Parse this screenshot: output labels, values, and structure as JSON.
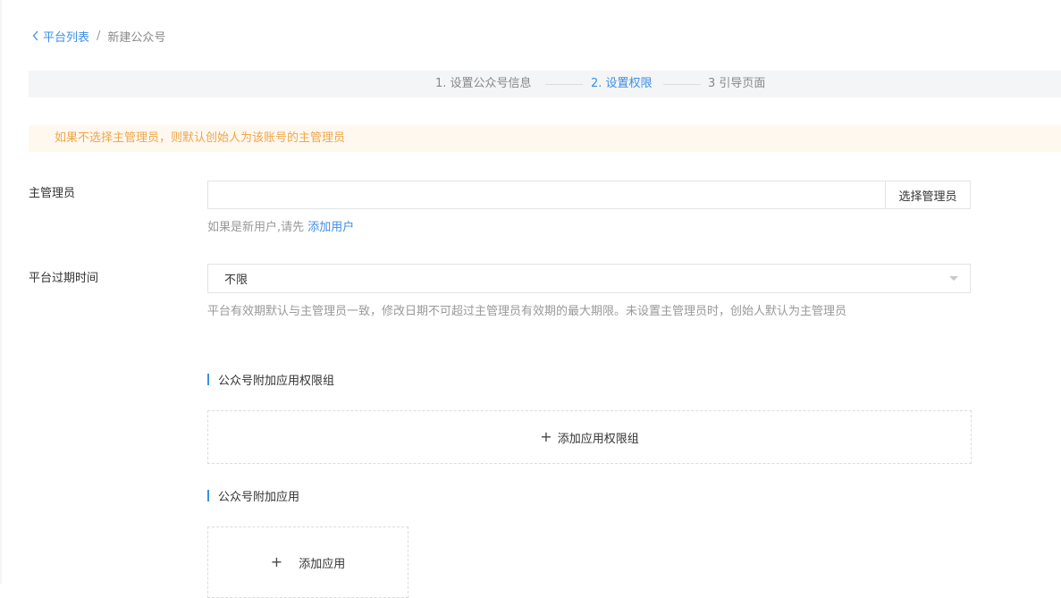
{
  "breadcrumb": {
    "back_label": "平台列表",
    "separator": "/",
    "current": "新建公众号"
  },
  "steps": [
    {
      "label": "1. 设置公众号信息",
      "active": false
    },
    {
      "label": "2. 设置权限",
      "active": true
    },
    {
      "label": "3 引导页面",
      "active": false
    }
  ],
  "alert": {
    "text": "如果不选择主管理员，则默认创始人为该账号的主管理员"
  },
  "admin": {
    "label": "主管理员",
    "value": "",
    "button_label": "选择管理员",
    "hint_prefix": "如果是新用户,请先",
    "hint_link": "添加用户"
  },
  "expiry": {
    "label": "平台过期时间",
    "selected": "不限",
    "hint": "平台有效期默认与主管理员一致，修改日期不可超过主管理员有效期的最大期限。未设置主管理员时，创始人默认为主管理员"
  },
  "perm_groups": {
    "title": "公众号附加应用权限组",
    "add_label": "添加应用权限组"
  },
  "apps": {
    "title": "公众号附加应用",
    "add_label": "添加应用"
  },
  "colors": {
    "accent": "#3d8ee6",
    "warning_text": "#f0a64a",
    "warning_bg": "#fff8ef"
  }
}
